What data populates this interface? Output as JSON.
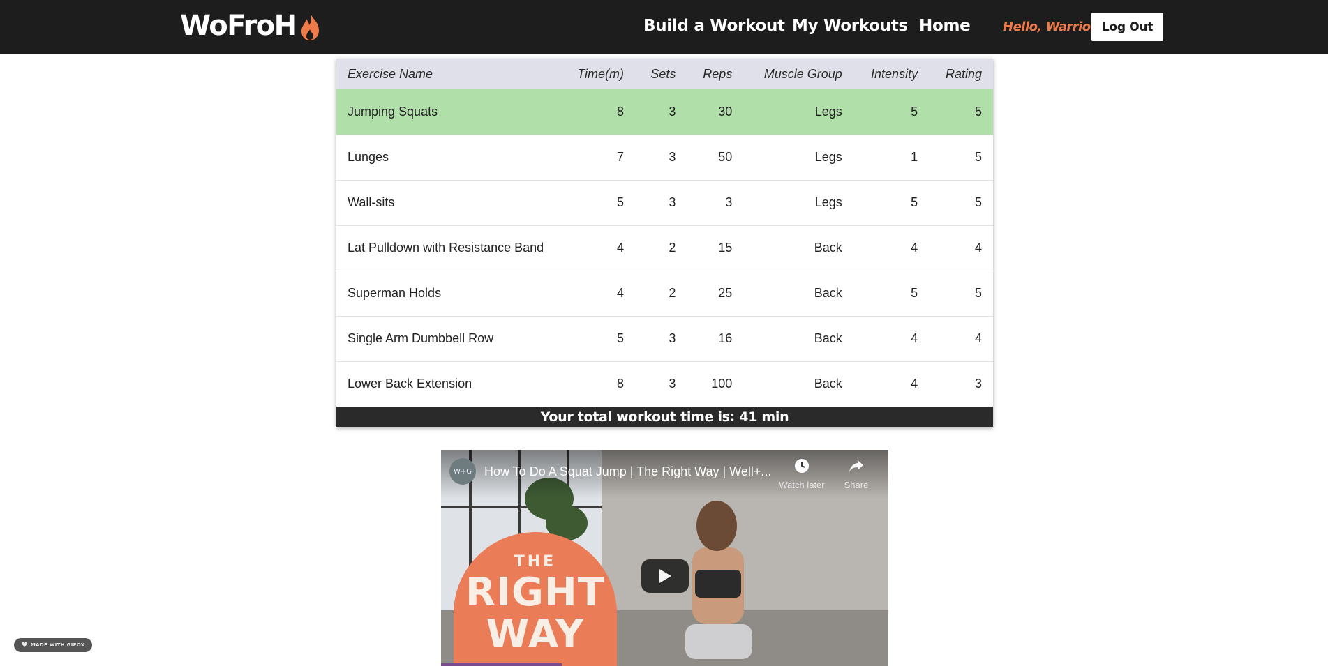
{
  "navbar": {
    "brand": "WoFroH",
    "links": [
      "Build a Workout",
      "My Workouts",
      "Home"
    ],
    "greeting": "Hello, Warrior",
    "logout_label": "Log Out"
  },
  "colors": {
    "nav_bg": "#1e1d1d",
    "accent": "#f07b4a",
    "active_row": "#b0dfaa",
    "header_row": "#e0e0ea"
  },
  "table": {
    "columns": [
      "Exercise Name",
      "Time(m)",
      "Sets",
      "Reps",
      "Muscle Group",
      "Intensity",
      "Rating"
    ],
    "rows": [
      [
        "Jumping Squats",
        "8",
        "3",
        "30",
        "Legs",
        "5",
        "5"
      ],
      [
        "Lunges",
        "7",
        "3",
        "50",
        "Legs",
        "1",
        "5"
      ],
      [
        "Wall-sits",
        "5",
        "3",
        "3",
        "Legs",
        "5",
        "5"
      ],
      [
        "Lat Pulldown with Resistance Band",
        "4",
        "2",
        "15",
        "Back",
        "4",
        "4"
      ],
      [
        "Superman Holds",
        "4",
        "2",
        "25",
        "Back",
        "5",
        "5"
      ],
      [
        "Single Arm Dumbbell Row",
        "5",
        "3",
        "16",
        "Back",
        "4",
        "4"
      ],
      [
        "Lower Back Extension",
        "8",
        "3",
        "100",
        "Back",
        "4",
        "3"
      ]
    ],
    "active_row_index": 0,
    "total_text": "Your total workout time is: 41 min"
  },
  "video": {
    "channel_badge": "W+G",
    "title": "How To Do A Squat Jump | The Right Way | Well+...",
    "watch_later_label": "Watch later",
    "share_label": "Share",
    "thumbnail_text_small": "THE",
    "thumbnail_text_line1": "RIGHT",
    "thumbnail_text_line2": "WAY",
    "progress": 0.27
  },
  "badge": {
    "label": "MADE WITH GIFOX"
  }
}
